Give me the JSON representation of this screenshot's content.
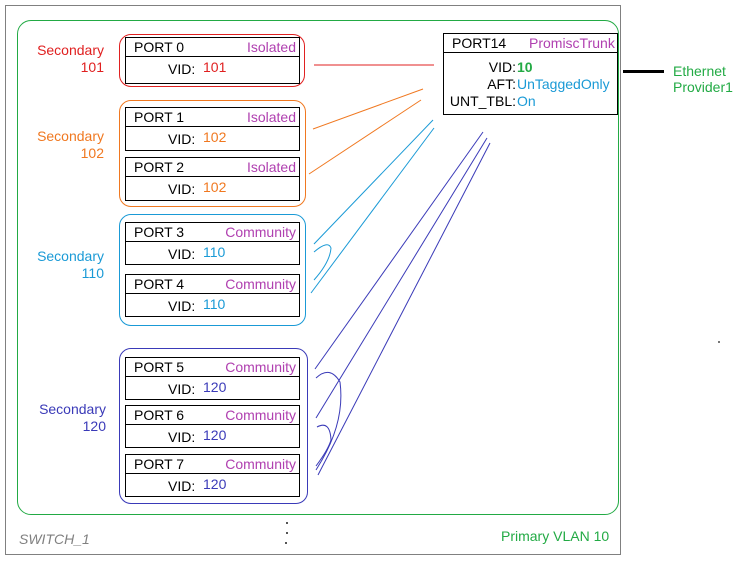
{
  "switch": {
    "name": "SWITCH_1",
    "primary_vlan_label": "Primary VLAN 10",
    "primary_color": "#22aa44"
  },
  "groups": [
    {
      "label_line1": "Secondary",
      "label_line2": "101",
      "color": "#e02020",
      "ports": [
        {
          "name": "PORT 0",
          "mode": "Isolated",
          "vid_label": "VID:",
          "vid": "101"
        }
      ]
    },
    {
      "label_line1": "Secondary",
      "label_line2": "102",
      "color": "#f07820",
      "ports": [
        {
          "name": "PORT 1",
          "mode": "Isolated",
          "vid_label": "VID:",
          "vid": "102"
        },
        {
          "name": "PORT 2",
          "mode": "Isolated",
          "vid_label": "VID:",
          "vid": "102"
        }
      ]
    },
    {
      "label_line1": "Secondary",
      "label_line2": "110",
      "color": "#1a9ad6",
      "ports": [
        {
          "name": "PORT 3",
          "mode": "Community",
          "vid_label": "VID:",
          "vid": "110"
        },
        {
          "name": "PORT 4",
          "mode": "Community",
          "vid_label": "VID:",
          "vid": "110"
        }
      ]
    },
    {
      "label_line1": "Secondary",
      "label_line2": "120",
      "color": "#3a3ab8",
      "ports": [
        {
          "name": "PORT 5",
          "mode": "Community",
          "vid_label": "VID:",
          "vid": "120"
        },
        {
          "name": "PORT 6",
          "mode": "Community",
          "vid_label": "VID:",
          "vid": "120"
        },
        {
          "name": "PORT 7",
          "mode": "Community",
          "vid_label": "VID:",
          "vid": "120"
        }
      ]
    }
  ],
  "trunk_port": {
    "name": "PORT14",
    "mode": "PromiscTrunk",
    "fields": [
      {
        "label": "VID:",
        "value": "10",
        "value_color": "#22aa44"
      },
      {
        "label": "AFT:",
        "value": "UnTaggedOnly",
        "value_color": "#1a9ad6"
      },
      {
        "label": "UNT_TBL:",
        "value": "On",
        "value_color": "#1a9ad6"
      }
    ]
  },
  "uplink": {
    "label_line1": "Ethernet",
    "label_line2": "Provider1"
  },
  "colors": {
    "mode_text": "#b040b0",
    "outer_border": "#808080"
  }
}
